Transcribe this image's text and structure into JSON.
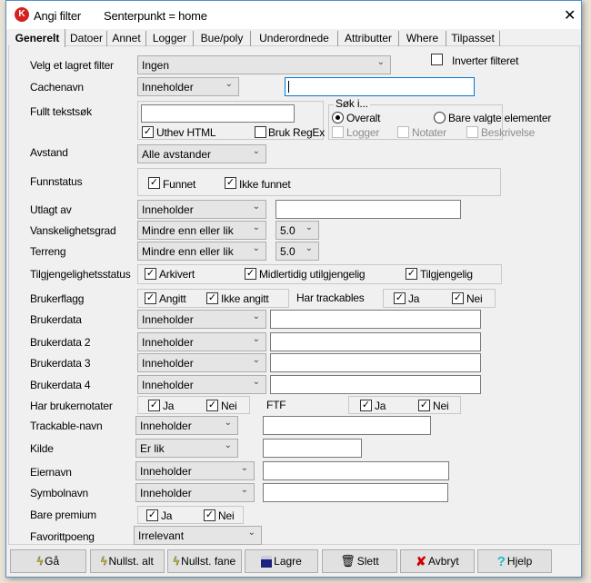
{
  "window": {
    "title": "Angi filter",
    "subtitle": "Senterpunkt = home",
    "close": "✕"
  },
  "tabs": [
    "Generelt",
    "Datoer",
    "Annet",
    "Logger",
    "Bue/poly",
    "Underordnede",
    "Attributter",
    "Where",
    "Tilpasset"
  ],
  "saved_filter": {
    "label": "Velg et lagret filter",
    "value": "Ingen"
  },
  "invert": {
    "label": "Inverter filteret",
    "checked": false
  },
  "cachename": {
    "label": "Cachenavn",
    "op": "Inneholder",
    "value": ""
  },
  "fulltext": {
    "label": "Fullt tekstsøk",
    "value": "",
    "highlight_html": "Uthev HTML",
    "regex": "Bruk RegEx"
  },
  "search_in": {
    "title": "Søk i...",
    "overall": "Overalt",
    "selected": "Bare valgte elementer",
    "logs": "Logger",
    "notes": "Notater",
    "description": "Beskrivelse"
  },
  "distance": {
    "label": "Avstand",
    "value": "Alle avstander"
  },
  "found": {
    "label": "Funnstatus",
    "found": "Funnet",
    "not_found": "Ikke funnet"
  },
  "placed_by": {
    "label": "Utlagt av",
    "op": "Inneholder",
    "value": ""
  },
  "difficulty": {
    "label": "Vanskelighetsgrad",
    "op": "Mindre enn eller lik",
    "value": "5.0"
  },
  "terrain": {
    "label": "Terreng",
    "op": "Mindre enn eller lik",
    "value": "5.0"
  },
  "availability": {
    "label": "Tilgjengelighetsstatus",
    "archived": "Arkivert",
    "temp": "Midlertidig utilgjengelig",
    "available": "Tilgjengelig"
  },
  "userflag": {
    "label": "Brukerflagg",
    "set": "Angitt",
    "not_set": "Ikke angitt"
  },
  "trackables": {
    "label": "Har trackables",
    "yes": "Ja",
    "no": "Nei"
  },
  "userdata": [
    {
      "label": "Brukerdata",
      "op": "Inneholder"
    },
    {
      "label": "Brukerdata 2",
      "op": "Inneholder"
    },
    {
      "label": "Brukerdata 3",
      "op": "Inneholder"
    },
    {
      "label": "Brukerdata 4",
      "op": "Inneholder"
    }
  ],
  "usernotes": {
    "label": "Har brukernotater",
    "yes": "Ja",
    "no": "Nei"
  },
  "ftf": {
    "label": "FTF",
    "yes": "Ja",
    "no": "Nei"
  },
  "trackable_name": {
    "label": "Trackable-navn",
    "op": "Inneholder"
  },
  "source": {
    "label": "Kilde",
    "op": "Er lik"
  },
  "owner": {
    "label": "Eiernavn",
    "op": "Inneholder"
  },
  "symbol": {
    "label": "Symbolnavn",
    "op": "Inneholder"
  },
  "premium": {
    "label": "Bare premium",
    "yes": "Ja",
    "no": "Nei"
  },
  "favorites": {
    "label": "Favorittpoeng",
    "value": "Irrelevant"
  },
  "buttons": {
    "go": "Gå",
    "reset_all": "Nullst. alt",
    "reset_tab": "Nullst. fane",
    "save": "Lagre",
    "delete": "Slett",
    "cancel": "Avbryt",
    "help": "Hjelp"
  },
  "check": "✓",
  "chev": "⌄",
  "colors": {
    "accent": "#0078d7",
    "lightning": "#f2e600",
    "cancel": "#d00000",
    "help": "#1fb8c8"
  }
}
